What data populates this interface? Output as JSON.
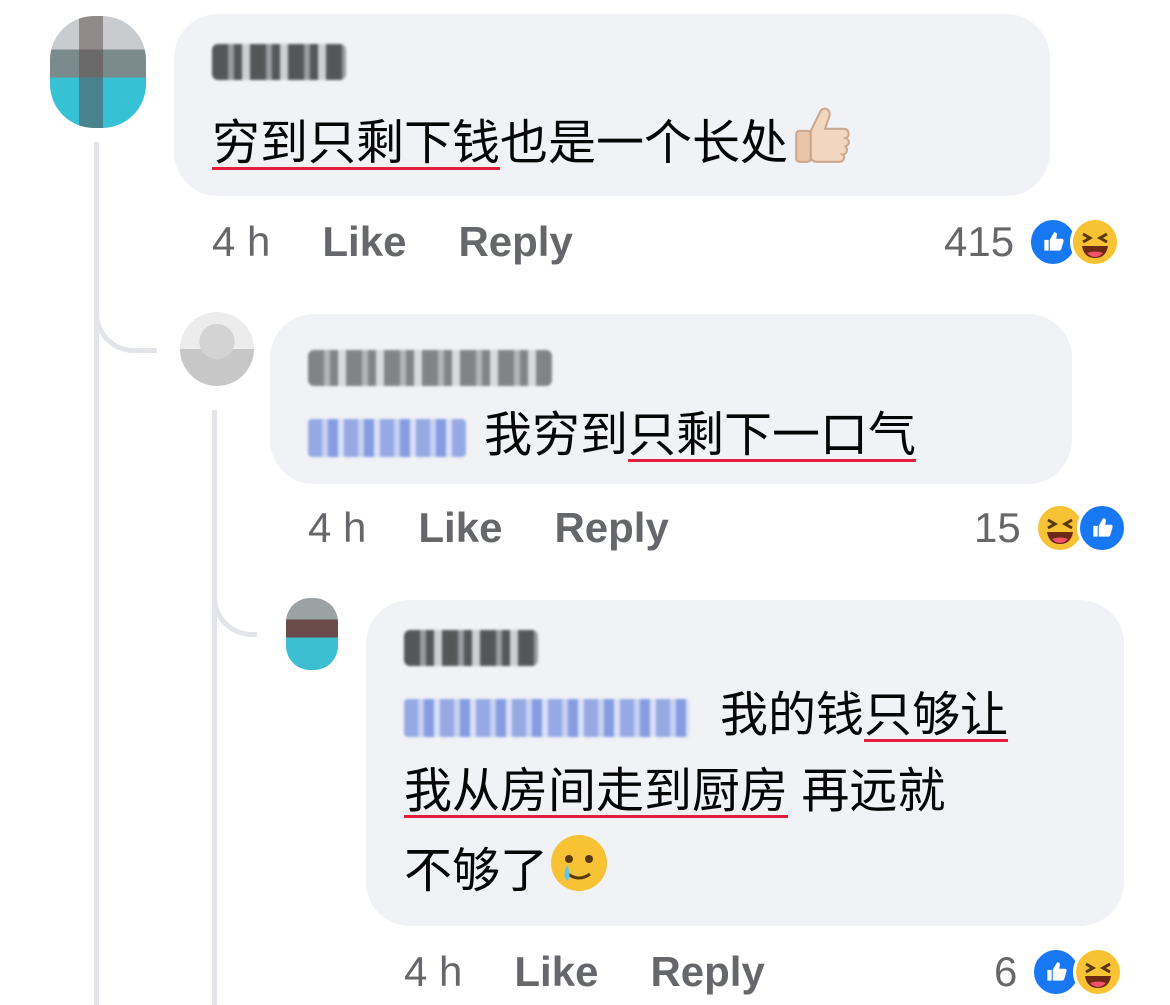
{
  "comments": [
    {
      "text_underlined": "穷到只剩下钱",
      "text_rest": "也是一个长处",
      "emoji": "thumbs-up-icon",
      "time": "4 h",
      "like_label": "Like",
      "reply_label": "Reply",
      "reaction_count": "415",
      "reactions": [
        "like-icon",
        "haha-icon"
      ]
    },
    {
      "text_plain": "我穷到",
      "text_underlined": "只剩下一口气",
      "time": "4 h",
      "like_label": "Like",
      "reply_label": "Reply",
      "reaction_count": "15",
      "reactions": [
        "haha-icon",
        "like-icon"
      ]
    },
    {
      "line1_plain": "我的钱",
      "line1_underlined": "只够让",
      "line2_underlined": "我从房间走到厨房",
      "line2_rest": " 再远就",
      "line3": "不够了",
      "emoji": "crying-smile-icon",
      "time": "4 h",
      "like_label": "Like",
      "reply_label": "Reply",
      "reaction_count": "6",
      "reactions": [
        "like-icon",
        "haha-icon"
      ]
    }
  ],
  "colors": {
    "bubble": "#f0f2f5",
    "underline": "#e41e3f",
    "meta_text": "#65676b",
    "like_blue": "#1877f2",
    "haha_yellow": "#f7c233"
  }
}
